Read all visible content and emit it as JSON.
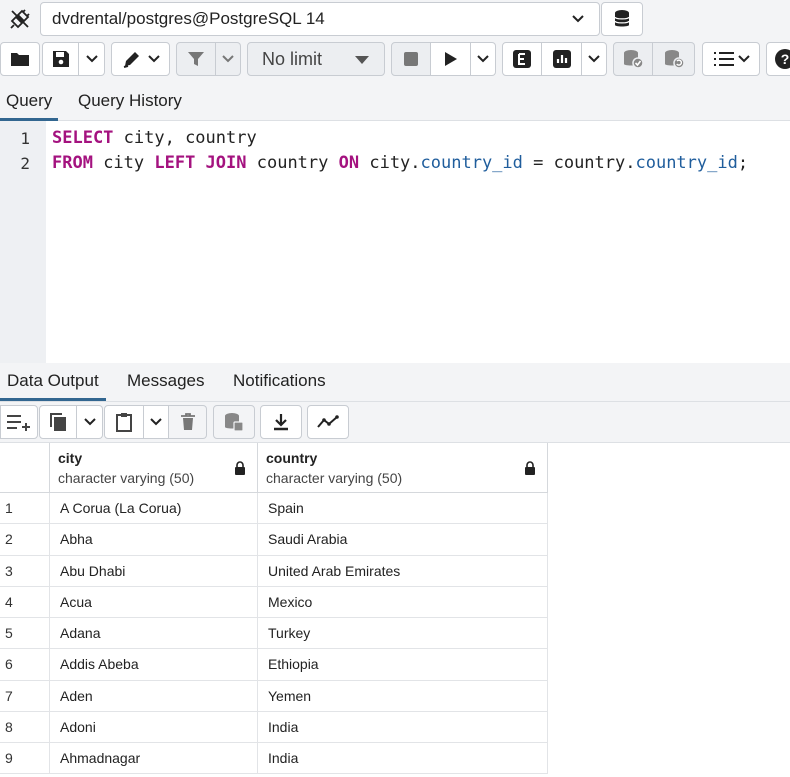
{
  "connection": {
    "label": "dvdrental/postgres@PostgreSQL 14"
  },
  "toolbar": {
    "limit_label": "No limit"
  },
  "query_tabs": [
    {
      "label": "Query"
    },
    {
      "label": "Query History"
    }
  ],
  "editor": {
    "lines": [
      {
        "num": "1"
      },
      {
        "num": "2"
      }
    ],
    "line1": {
      "kw1": "SELECT",
      "rest": " city, country"
    },
    "line2": {
      "kw1": "FROM",
      "t1": " city ",
      "kw2": "LEFT JOIN",
      "t2": " country ",
      "kw3": "ON",
      "t3": " city.",
      "p1": "country_id",
      "t4": " = country.",
      "p2": "country_id",
      "t5": ";"
    }
  },
  "output_tabs": [
    {
      "label": "Data Output"
    },
    {
      "label": "Messages"
    },
    {
      "label": "Notifications"
    }
  ],
  "grid": {
    "columns": [
      {
        "name": "city",
        "type": "character varying (50)"
      },
      {
        "name": "country",
        "type": "character varying (50)"
      }
    ],
    "rows": [
      {
        "n": "1",
        "city": "A Corua (La Corua)",
        "country": "Spain"
      },
      {
        "n": "2",
        "city": "Abha",
        "country": "Saudi Arabia"
      },
      {
        "n": "3",
        "city": "Abu Dhabi",
        "country": "United Arab Emirates"
      },
      {
        "n": "4",
        "city": "Acua",
        "country": "Mexico"
      },
      {
        "n": "5",
        "city": "Adana",
        "country": "Turkey"
      },
      {
        "n": "6",
        "city": "Addis Abeba",
        "country": "Ethiopia"
      },
      {
        "n": "7",
        "city": "Aden",
        "country": "Yemen"
      },
      {
        "n": "8",
        "city": "Adoni",
        "country": "India"
      },
      {
        "n": "9",
        "city": "Ahmadnagar",
        "country": "India"
      }
    ]
  },
  "colors": {
    "keyword": "#a4127f",
    "property": "#1f5d9c",
    "active_tab": "#326690"
  }
}
